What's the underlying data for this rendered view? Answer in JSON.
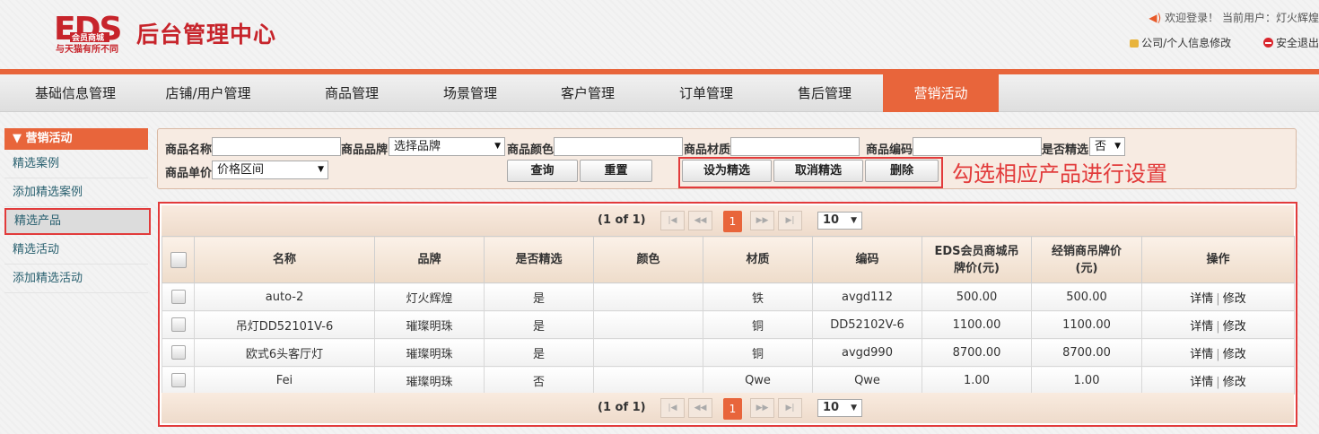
{
  "header": {
    "logo_letters": "EDS",
    "logo_badge": "会员商城",
    "title": "后台管理中心",
    "slogan": "与天猫有所不同",
    "welcome": "欢迎登录！ 当前用户：灯火辉煌",
    "profile_link": "公司/个人信息修改",
    "logout_link": "安全退出"
  },
  "nav": {
    "items": [
      "基础信息管理",
      "店铺/用户管理",
      "商品管理",
      "场景管理",
      "客户管理",
      "订单管理",
      "售后管理",
      "营销活动"
    ],
    "active_index": 7
  },
  "sidebar": {
    "heading": "▼ 营销活动",
    "items": [
      "精选案例",
      "添加精选案例",
      "精选产品",
      "精选活动",
      "添加精选活动"
    ],
    "selected_index": 2
  },
  "search": {
    "name_label": "商品名称",
    "brand_label": "商品品牌",
    "brand_value": "选择品牌",
    "color_label": "商品颜色",
    "material_label": "商品材质",
    "code_label": "商品编码",
    "featured_label": "是否精选",
    "featured_value": "否",
    "price_label": "商品单价",
    "price_value": "价格区间",
    "query_button": "查询",
    "reset_button": "重置",
    "set_featured_button": "设为精选",
    "cancel_featured_button": "取消精选",
    "delete_button": "删除"
  },
  "annotation": "勾选相应产品进行设置",
  "pager": {
    "info": "(1 of 1)",
    "current_page": "1",
    "page_size": "10",
    "first": "|◀",
    "prev": "◀◀",
    "next": "▶▶",
    "last": "▶|"
  },
  "table": {
    "columns": [
      "名称",
      "品牌",
      "是否精选",
      "颜色",
      "材质",
      "编码",
      "EDS会员商城吊牌价(元)",
      "经销商吊牌价(元)",
      "操作"
    ],
    "rows": [
      {
        "name": "auto-2",
        "brand": "灯火辉煌",
        "featured": "是",
        "color": "",
        "material": "铁",
        "code": "avgd112",
        "eds_price": "500.00",
        "dealer_price": "500.00"
      },
      {
        "name": "吊灯DD52101V-6",
        "brand": "璀璨明珠",
        "featured": "是",
        "color": "",
        "material": "铜",
        "code": "DD52102V-6",
        "eds_price": "1100.00",
        "dealer_price": "1100.00"
      },
      {
        "name": "欧式6头客厅灯",
        "brand": "璀璨明珠",
        "featured": "是",
        "color": "",
        "material": "铜",
        "code": "avgd990",
        "eds_price": "8700.00",
        "dealer_price": "8700.00"
      },
      {
        "name": "Fei",
        "brand": "璀璨明珠",
        "featured": "否",
        "color": "",
        "material": "Qwe",
        "code": "Qwe",
        "eds_price": "1.00",
        "dealer_price": "1.00"
      }
    ],
    "detail_link": "详情",
    "edit_link": "修改",
    "link_separator": "|"
  },
  "colors": {
    "accent": "#e8653b",
    "highlight_border": "#e23b3b",
    "brand_red": "#c7242b"
  }
}
